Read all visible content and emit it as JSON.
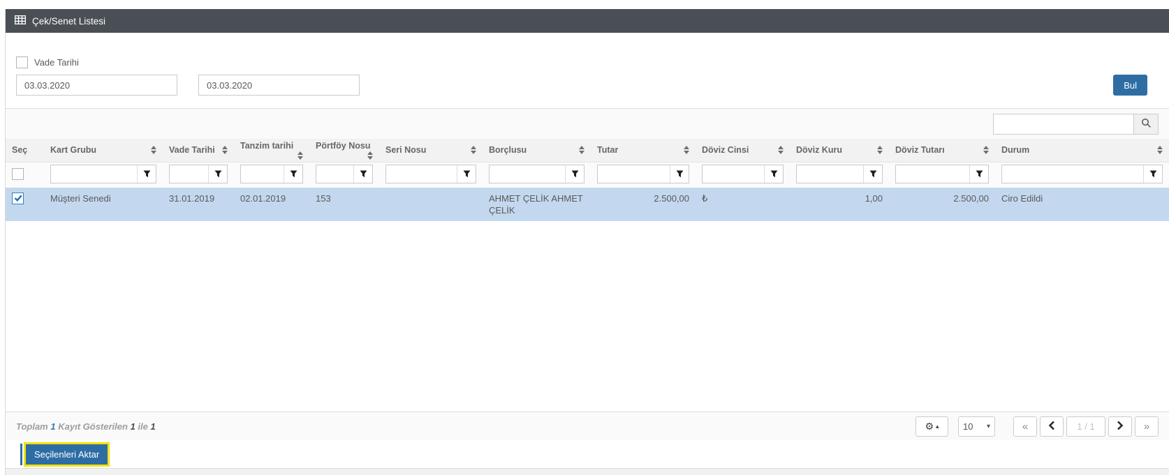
{
  "colors": {
    "title_bar_bg": "#494f55",
    "accent_blue": "#2e6da4",
    "row_highlight": "#c3d8ee",
    "focus_yellow": "#f3e103"
  },
  "header": {
    "title": "Çek/Senet Listesi"
  },
  "filters": {
    "vade_label": "Vade Tarihi",
    "vade_checked": false,
    "date_from": "03.03.2020",
    "date_to": "03.03.2020",
    "bul_label": "Bul"
  },
  "search": {
    "value": ""
  },
  "table": {
    "columns": [
      {
        "label": "Seç",
        "sortable": false
      },
      {
        "label": "Kart Grubu",
        "sortable": true
      },
      {
        "label": "Vade Tarihi",
        "sortable": true
      },
      {
        "label": "Tanzim tarihi",
        "sortable": true
      },
      {
        "label": "Pörtföy Nosu",
        "sortable": true
      },
      {
        "label": "Seri Nosu",
        "sortable": true
      },
      {
        "label": "Borçlusu",
        "sortable": true
      },
      {
        "label": "Tutar",
        "sortable": true
      },
      {
        "label": "Döviz Cinsi",
        "sortable": true
      },
      {
        "label": "Döviz Kuru",
        "sortable": true
      },
      {
        "label": "Döviz Tutarı",
        "sortable": true
      },
      {
        "label": "Durum",
        "sortable": true
      }
    ],
    "rows": [
      {
        "selected": true,
        "cells": [
          "Müşteri Senedi",
          "31.01.2019",
          "02.01.2019",
          "153",
          "",
          "AHMET ÇELİK AHMET ÇELİK",
          "2.500,00",
          "₺",
          "1,00",
          "2.500,00",
          "Ciro Edildi"
        ]
      }
    ]
  },
  "footer": {
    "summary": {
      "label_total": "Toplam",
      "total": "1",
      "label_shown": "Kayıt Gösterilen",
      "from": "1",
      "label_ile": "ile",
      "to": "1"
    },
    "pagination": {
      "page_size": "10",
      "indicator": "1 / 1"
    }
  },
  "actions": {
    "transfer_label": "Seçilenleri Aktar"
  },
  "icons": {
    "gear": "⚙",
    "caret_up": "▴",
    "caret_down": "▾",
    "double_left": "«",
    "double_right": "»"
  }
}
